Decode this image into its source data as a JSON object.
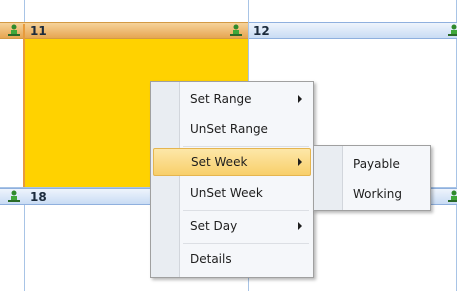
{
  "calendar": {
    "weeks": [
      {
        "days": [
          {
            "number": "11",
            "selected": true
          },
          {
            "number": "12",
            "selected": false
          }
        ]
      },
      {
        "days": [
          {
            "number": "18",
            "selected": false
          }
        ]
      }
    ],
    "selection_color": "#ffd200",
    "header_color": "#c9dcf4",
    "resource_icon": "person-at-desk-icon"
  },
  "context_menu": {
    "items": [
      {
        "label": "Set Range",
        "has_submenu": true
      },
      {
        "label": "UnSet Range",
        "has_submenu": false
      },
      {
        "label": "Set Week",
        "has_submenu": true,
        "highlighted": true
      },
      {
        "label": "UnSet Week",
        "has_submenu": false
      },
      {
        "label": "Set Day",
        "has_submenu": true
      },
      {
        "label": "Details",
        "has_submenu": false
      }
    ]
  },
  "submenu": {
    "items": [
      {
        "label": "Payable"
      },
      {
        "label": "Working"
      }
    ]
  }
}
